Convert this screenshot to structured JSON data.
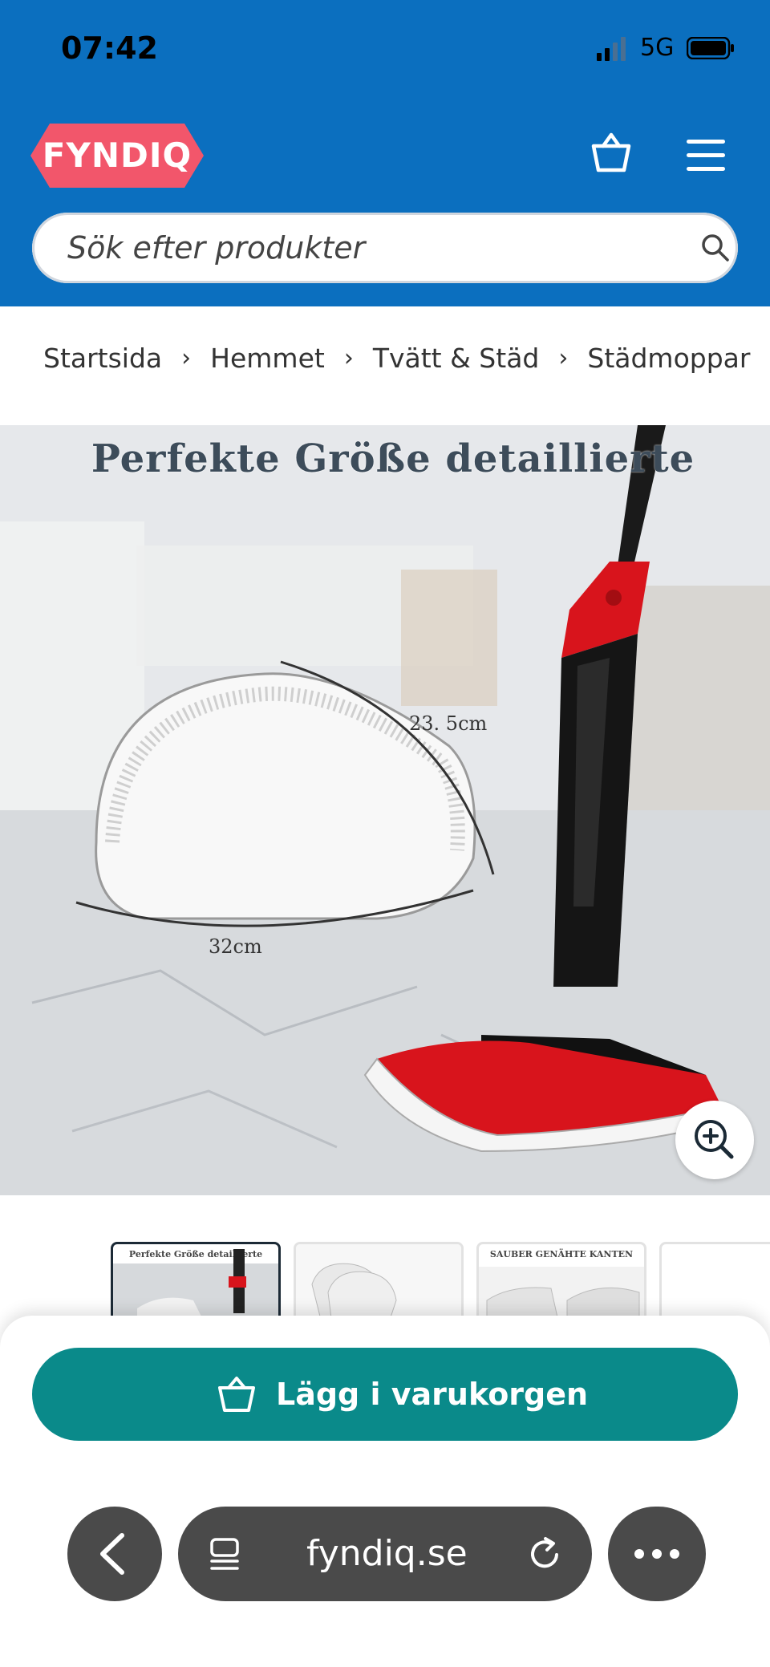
{
  "status_bar": {
    "time": "07:42",
    "network": "5G"
  },
  "header": {
    "logo_text": "FYNDIQ",
    "search_placeholder": "Sök efter produkter"
  },
  "breadcrumb": [
    "Startsida",
    "Hemmet",
    "Tvätt & Städ",
    "Städmoppar"
  ],
  "product_image": {
    "title": "Perfekte Größe detaillierte",
    "dim_side": "23. 5cm",
    "dim_bottom": "32cm"
  },
  "thumbnails": {
    "thumb1_caption": "Perfekte Größe detaillierte",
    "thumb3_caption": "SAUBER GENÄHTE KANTEN"
  },
  "actions": {
    "add_to_cart": "Lägg i varukorgen"
  },
  "browser": {
    "url": "fyndiq.se"
  },
  "colors": {
    "header_bg": "#0b6fbf",
    "logo_bg": "#f2566b",
    "cta_bg": "#0a8a8a",
    "mop_red": "#d8141c"
  },
  "icons": [
    "cart-icon",
    "menu-icon",
    "search-icon",
    "zoom-in-icon",
    "back-chevron-icon",
    "tabs-icon",
    "reload-icon",
    "more-icon"
  ]
}
